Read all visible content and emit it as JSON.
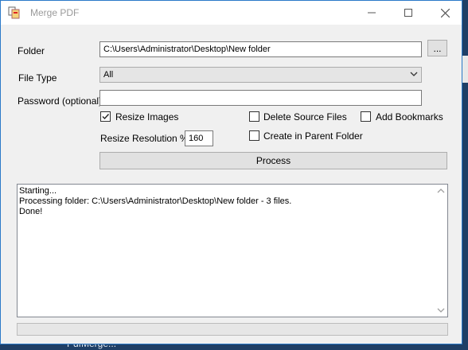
{
  "window": {
    "title": "Merge PDF"
  },
  "form": {
    "folder_label": "Folder",
    "folder_value": "C:\\Users\\Administrator\\Desktop\\New folder",
    "browse_label": "...",
    "file_type_label": "File Type",
    "file_type_value": "All",
    "password_label": "Password (optional)",
    "password_value": "",
    "resize_images_label": "Resize Images",
    "resize_images_checked": true,
    "delete_source_label": "Delete Source Files",
    "delete_source_checked": false,
    "add_bookmarks_label": "Add Bookmarks",
    "add_bookmarks_checked": false,
    "create_parent_label": "Create in Parent Folder",
    "create_parent_checked": false,
    "resize_resolution_label": "Resize Resolution %",
    "resize_resolution_value": "160",
    "process_label": "Process"
  },
  "log": {
    "lines": [
      "Starting...",
      "Processing folder: C:\\Users\\Administrator\\Desktop\\New folder - 3 files.",
      "Done!"
    ]
  },
  "progress": {
    "value": 0
  },
  "desktop": {
    "partial_label": "PdfMerge..."
  },
  "colors": {
    "window_border": "#2b79c8",
    "desktop": "#1f3f66",
    "progress": "#06b025"
  }
}
